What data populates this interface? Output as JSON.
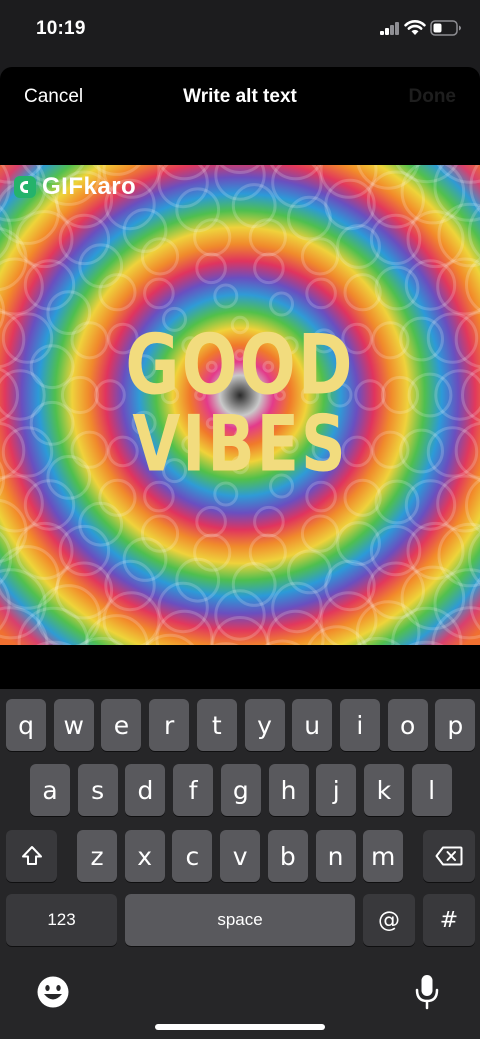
{
  "status_bar": {
    "time": "10:19"
  },
  "nav": {
    "cancel": "Cancel",
    "title": "Write alt text",
    "done": "Done"
  },
  "gif": {
    "watermark": "GIFkaro",
    "caption_line1": "GOOD",
    "caption_line2": "VIBES"
  },
  "keyboard": {
    "row1": [
      "q",
      "w",
      "e",
      "r",
      "t",
      "y",
      "u",
      "i",
      "o",
      "p"
    ],
    "row2": [
      "a",
      "s",
      "d",
      "f",
      "g",
      "h",
      "j",
      "k",
      "l"
    ],
    "row3": [
      "z",
      "x",
      "c",
      "v",
      "b",
      "n",
      "m"
    ],
    "numbers_label": "123",
    "space_label": "space",
    "at_label": "@",
    "hash_label": "#",
    "icons": {
      "shift": "shift-icon",
      "delete": "delete-icon",
      "emoji": "emoji-icon",
      "mic": "microphone-icon"
    }
  },
  "colors": {
    "sheet": "#000000",
    "keyboard": "#262628",
    "key": "#59595d",
    "key_dark": "#39393c",
    "caption": "#f2dc7e",
    "watermark_mark": "#24b36b"
  }
}
